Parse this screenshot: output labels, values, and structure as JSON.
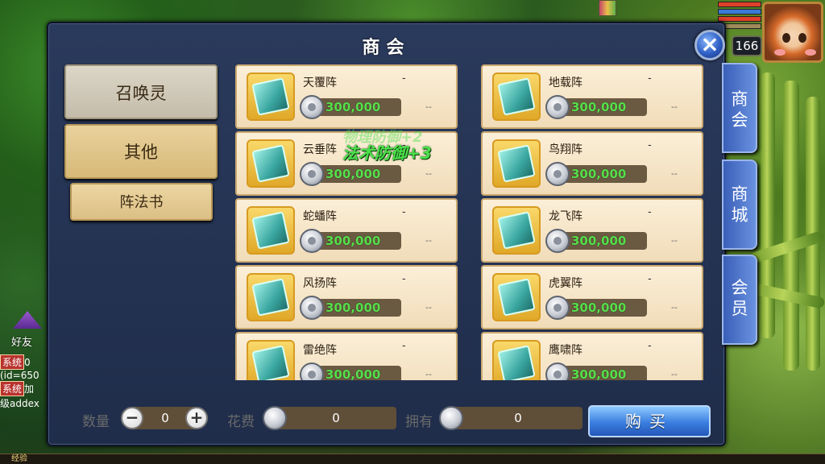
{
  "hud": {
    "level": "166",
    "exp_label": "经验"
  },
  "friend": {
    "label": "好友"
  },
  "chat": {
    "lines": [
      {
        "tag": "系统",
        "text": "0"
      },
      {
        "tag": "",
        "text": "(id=650"
      },
      {
        "tag": "系统",
        "text": "加"
      },
      {
        "tag": "",
        "text": "级addex"
      }
    ]
  },
  "panel": {
    "title": "商会",
    "close_label": "×"
  },
  "categories": [
    {
      "label": "召唤灵"
    },
    {
      "label": "其他"
    },
    {
      "label": "阵法书"
    }
  ],
  "items": [
    {
      "name": "天覆阵",
      "dash": "-",
      "price": "300,000",
      "tail": "--"
    },
    {
      "name": "地载阵",
      "dash": "-",
      "price": "300,000",
      "tail": "--"
    },
    {
      "name": "云垂阵",
      "dash": "-",
      "price": "300,000",
      "tail": "--"
    },
    {
      "name": "鸟翔阵",
      "dash": "-",
      "price": "300,000",
      "tail": "--"
    },
    {
      "name": "蛇蟠阵",
      "dash": "-",
      "price": "300,000",
      "tail": "--"
    },
    {
      "name": "龙飞阵",
      "dash": "-",
      "price": "300,000",
      "tail": "--"
    },
    {
      "name": "风扬阵",
      "dash": "-",
      "price": "300,000",
      "tail": "--"
    },
    {
      "name": "虎翼阵",
      "dash": "-",
      "price": "300,000",
      "tail": "--"
    },
    {
      "name": "雷绝阵",
      "dash": "-",
      "price": "300,000",
      "tail": "--"
    },
    {
      "name": "鹰啸阵",
      "dash": "-",
      "price": "300,000",
      "tail": "--"
    }
  ],
  "floating": {
    "main": "法术防御+3",
    "ghost": "物理防御+2"
  },
  "bottom": {
    "qty_label": "数量",
    "qty_value": "0",
    "minus": "−",
    "plus": "+",
    "cost_label": "花费",
    "cost_value": "0",
    "own_label": "拥有",
    "own_value": "0",
    "buy_label": "购买"
  },
  "tabs": [
    {
      "chars": [
        "商",
        "会"
      ]
    },
    {
      "chars": [
        "商",
        "城"
      ]
    },
    {
      "chars": [
        "会",
        "员"
      ]
    }
  ],
  "colors": {
    "price_text": "#57e04a",
    "buy_button": "#3a7ee0",
    "tab_blue": "#4a70c8"
  }
}
